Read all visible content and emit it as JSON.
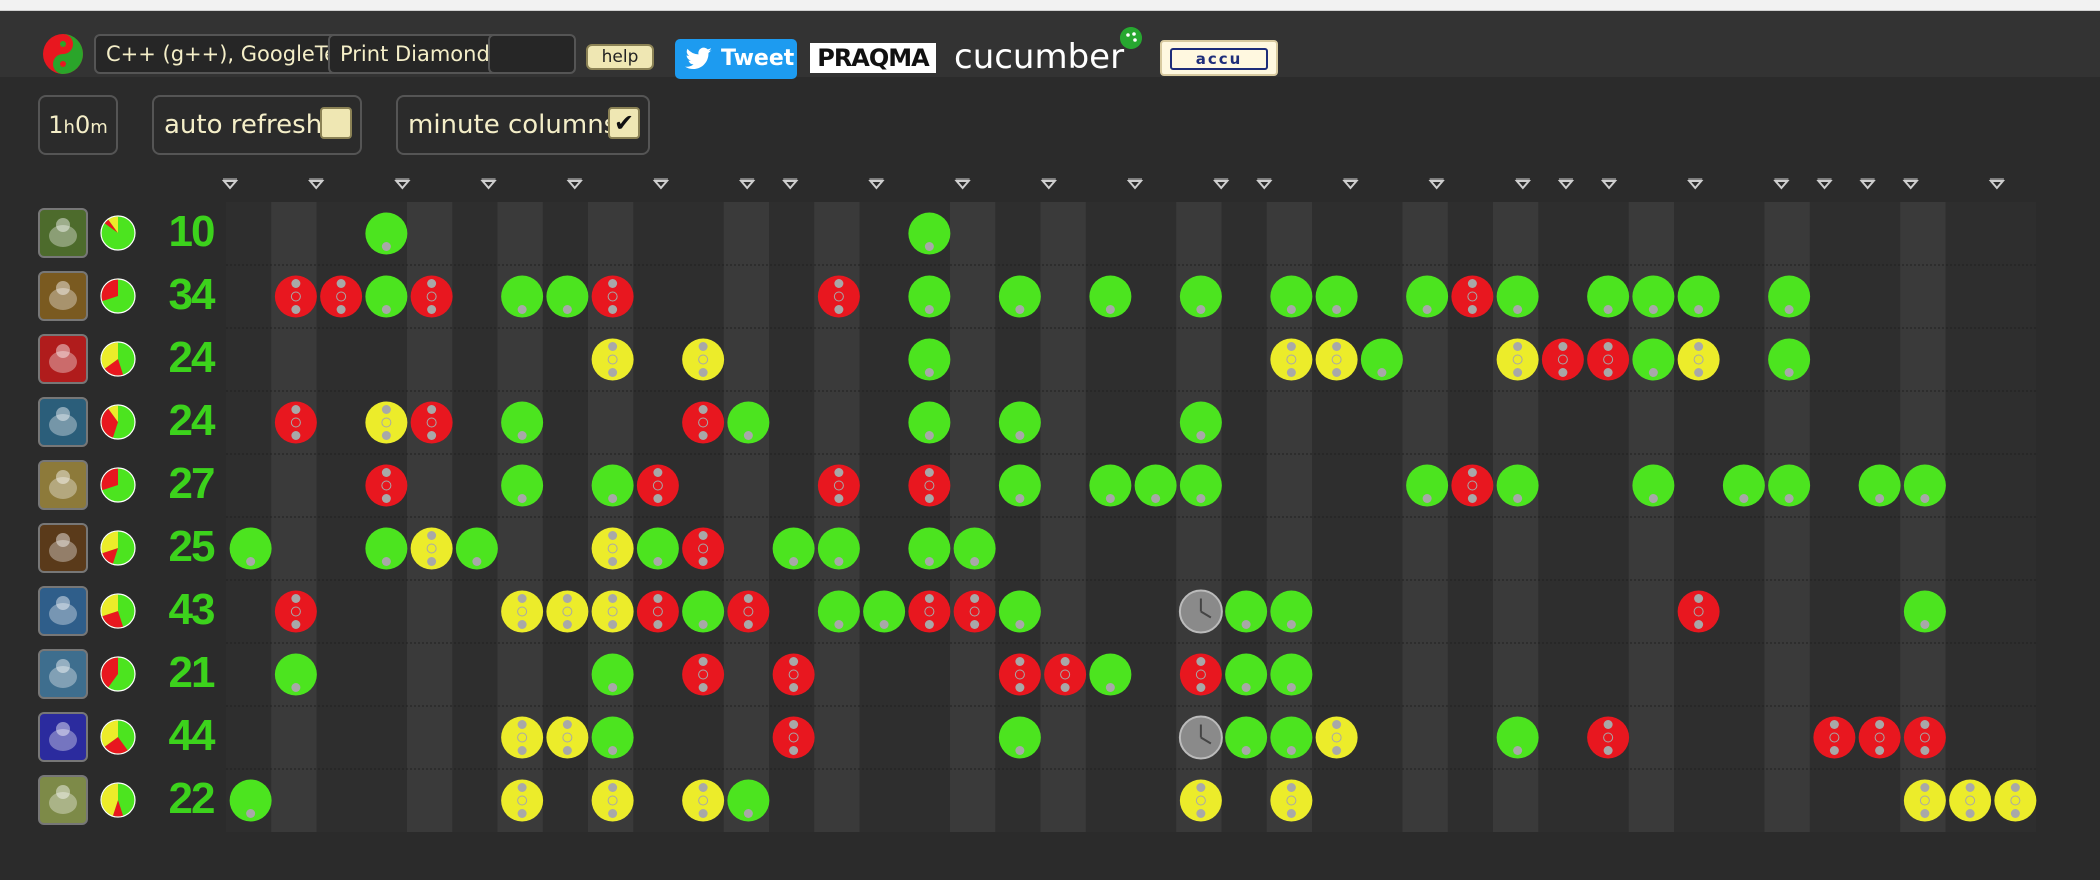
{
  "header": {
    "language": "C++ (g++), GoogleTest",
    "exercise": "Print Diamond",
    "help_label": "help",
    "tweet_label": "Tweet",
    "sponsors": {
      "praqma": "PRAQMA",
      "cucumber": "cucumber",
      "accu": "accu"
    }
  },
  "controls": {
    "duration": {
      "hours": "1",
      "h": "h",
      "minutes": "0",
      "m": "m"
    },
    "auto_refresh": {
      "label": "auto refresh",
      "checked": false
    },
    "minute_columns": {
      "label": "minute columns",
      "checked": true
    }
  },
  "colors": {
    "green": "#4ce41f",
    "red": "#e8171f",
    "yellow": "#ecec2a",
    "amber": "#bfbf00",
    "count": "#3cd21c"
  },
  "columns": 39,
  "pointer_columns": [
    0,
    2,
    4,
    6,
    8,
    10,
    12,
    13,
    15,
    17,
    19,
    21,
    23,
    24,
    26,
    28,
    30,
    31,
    32,
    34,
    36,
    37,
    38,
    39,
    41
  ],
  "animals": [
    {
      "avatar": "bee-icon",
      "count": "10",
      "pie": {
        "green": 0.85,
        "red": 0.05,
        "yellow": 0.1
      },
      "lights": [
        [
          3,
          "green"
        ],
        [
          15,
          "green"
        ]
      ]
    },
    {
      "avatar": "butterfly-icon",
      "count": "34",
      "pie": {
        "green": 0.7,
        "red": 0.3,
        "yellow": 0.0
      },
      "lights": [
        [
          1,
          "red"
        ],
        [
          2,
          "red"
        ],
        [
          3,
          "green"
        ],
        [
          4,
          "red"
        ],
        [
          6,
          "green"
        ],
        [
          7,
          "green"
        ],
        [
          8,
          "red"
        ],
        [
          13,
          "red"
        ],
        [
          15,
          "green"
        ],
        [
          17,
          "green"
        ],
        [
          19,
          "green"
        ],
        [
          21,
          "green"
        ],
        [
          23,
          "green"
        ],
        [
          24,
          "green"
        ],
        [
          26,
          "green"
        ],
        [
          27,
          "red"
        ],
        [
          28,
          "green"
        ],
        [
          30,
          "green"
        ],
        [
          31,
          "green"
        ],
        [
          32,
          "green"
        ],
        [
          34,
          "green"
        ]
      ]
    },
    {
      "avatar": "elephant-icon",
      "count": "24",
      "pie": {
        "green": 0.45,
        "red": 0.2,
        "yellow": 0.35
      },
      "lights": [
        [
          8,
          "yellow"
        ],
        [
          10,
          "yellow"
        ],
        [
          15,
          "green"
        ],
        [
          23,
          "yellow"
        ],
        [
          24,
          "yellow"
        ],
        [
          25,
          "green"
        ],
        [
          28,
          "yellow"
        ],
        [
          29,
          "red"
        ],
        [
          30,
          "red"
        ],
        [
          31,
          "green"
        ],
        [
          32,
          "yellow"
        ],
        [
          34,
          "green"
        ]
      ]
    },
    {
      "avatar": "fox-icon",
      "count": "24",
      "pie": {
        "green": 0.55,
        "red": 0.35,
        "yellow": 0.1
      },
      "lights": [
        [
          1,
          "red"
        ],
        [
          3,
          "yellow"
        ],
        [
          4,
          "red"
        ],
        [
          6,
          "green"
        ],
        [
          10,
          "red"
        ],
        [
          11,
          "green"
        ],
        [
          15,
          "green"
        ],
        [
          17,
          "green"
        ],
        [
          21,
          "green"
        ]
      ]
    },
    {
      "avatar": "bear-icon",
      "count": "27",
      "pie": {
        "green": 0.7,
        "red": 0.3,
        "yellow": 0.0
      },
      "lights": [
        [
          3,
          "red"
        ],
        [
          6,
          "green"
        ],
        [
          8,
          "green"
        ],
        [
          9,
          "red"
        ],
        [
          13,
          "red"
        ],
        [
          15,
          "red"
        ],
        [
          17,
          "green"
        ],
        [
          19,
          "green"
        ],
        [
          20,
          "green"
        ],
        [
          21,
          "green"
        ],
        [
          26,
          "green"
        ],
        [
          27,
          "red"
        ],
        [
          28,
          "green"
        ],
        [
          31,
          "green"
        ],
        [
          33,
          "green"
        ],
        [
          34,
          "green"
        ],
        [
          36,
          "green"
        ],
        [
          37,
          "green"
        ]
      ]
    },
    {
      "avatar": "lobster-icon",
      "count": "25",
      "pie": {
        "green": 0.55,
        "red": 0.15,
        "yellow": 0.3
      },
      "lights": [
        [
          0,
          "green"
        ],
        [
          3,
          "green"
        ],
        [
          4,
          "yellow"
        ],
        [
          5,
          "green"
        ],
        [
          8,
          "yellow"
        ],
        [
          9,
          "green"
        ],
        [
          10,
          "red"
        ],
        [
          12,
          "green"
        ],
        [
          13,
          "green"
        ],
        [
          15,
          "green"
        ],
        [
          16,
          "green"
        ]
      ]
    },
    {
      "avatar": "squid-icon",
      "count": "43",
      "pie": {
        "green": 0.45,
        "red": 0.25,
        "yellow": 0.3
      },
      "lights": [
        [
          1,
          "red"
        ],
        [
          6,
          "yellow"
        ],
        [
          7,
          "yellow"
        ],
        [
          8,
          "yellow"
        ],
        [
          9,
          "red"
        ],
        [
          10,
          "green"
        ],
        [
          11,
          "red"
        ],
        [
          13,
          "green"
        ],
        [
          14,
          "green"
        ],
        [
          15,
          "red"
        ],
        [
          16,
          "red"
        ],
        [
          17,
          "green"
        ],
        [
          21,
          "clock"
        ],
        [
          22,
          "green"
        ],
        [
          23,
          "green"
        ],
        [
          32,
          "red"
        ],
        [
          37,
          "green"
        ]
      ]
    },
    {
      "avatar": "swan-icon",
      "count": "21",
      "pie": {
        "green": 0.6,
        "red": 0.4,
        "yellow": 0.0
      },
      "lights": [
        [
          1,
          "green"
        ],
        [
          8,
          "green"
        ],
        [
          10,
          "red"
        ],
        [
          12,
          "red"
        ],
        [
          17,
          "red"
        ],
        [
          18,
          "red"
        ],
        [
          19,
          "green"
        ],
        [
          21,
          "red"
        ],
        [
          22,
          "green"
        ],
        [
          23,
          "green"
        ]
      ]
    },
    {
      "avatar": "shark-icon",
      "count": "44",
      "pie": {
        "green": 0.4,
        "red": 0.25,
        "yellow": 0.35
      },
      "lights": [
        [
          6,
          "yellow"
        ],
        [
          7,
          "yellow"
        ],
        [
          8,
          "green"
        ],
        [
          12,
          "red"
        ],
        [
          17,
          "green"
        ],
        [
          21,
          "clock"
        ],
        [
          22,
          "green"
        ],
        [
          23,
          "green"
        ],
        [
          24,
          "yellow"
        ],
        [
          28,
          "green"
        ],
        [
          30,
          "red"
        ],
        [
          35,
          "red"
        ],
        [
          36,
          "red"
        ],
        [
          37,
          "red"
        ]
      ]
    },
    {
      "avatar": "wolf-icon",
      "count": "22",
      "pie": {
        "green": 0.45,
        "red": 0.1,
        "yellow": 0.45
      },
      "lights": [
        [
          0,
          "green"
        ],
        [
          6,
          "yellow"
        ],
        [
          8,
          "yellow"
        ],
        [
          10,
          "yellow"
        ],
        [
          11,
          "green"
        ],
        [
          21,
          "yellow"
        ],
        [
          23,
          "yellow"
        ],
        [
          37,
          "yellow"
        ],
        [
          38,
          "yellow"
        ],
        [
          39,
          "yellow"
        ]
      ]
    }
  ]
}
